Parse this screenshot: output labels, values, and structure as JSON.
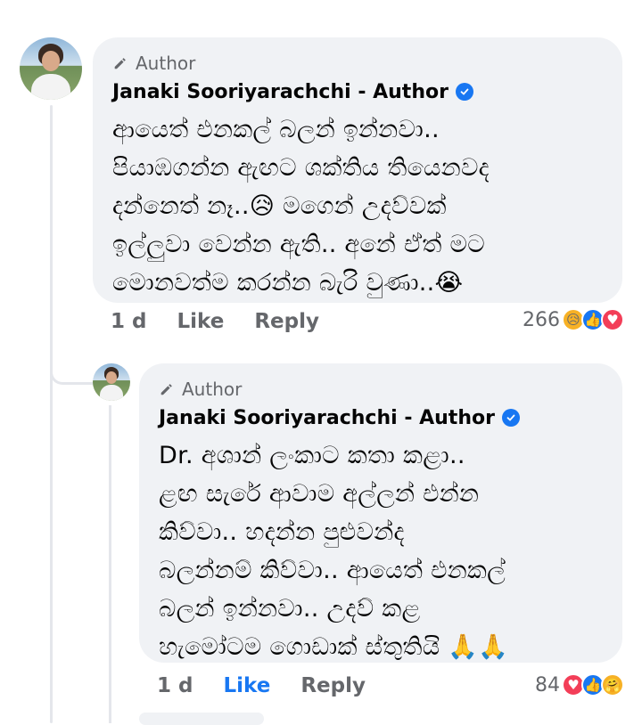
{
  "comments": [
    {
      "badge": "Author",
      "name": "Janaki Sooriyarachchi - Author",
      "text": "ආයෙත් එනකල් බලන් ඉන්නවා..\nපියාඹගන්න ඇඟට ශක්තිය තියෙනවද\nදන්නෙත් නෑ..😥 මගෙන් උදව්වක්\nඉල්ලුවා වෙන්න ඇති.. අනේ ඒත් මට\nමොනවත්ම කරන්න බැරි වුණා..😭",
      "time": "1 d",
      "like_label": "Like",
      "reply_label": "Reply",
      "reaction_count": "266",
      "reactions": [
        "sad",
        "like",
        "love"
      ]
    },
    {
      "badge": "Author",
      "name": "Janaki Sooriyarachchi - Author",
      "text": "Dr. අශාන් ලංකාට කතා කළා..\nළඟ සැරේ ආවාම අල්ලන් එන්න\nකිව්වා.. හදන්න පුළුවන්ද\nබලන්නම් කිව්වා.. ආයෙත් එනකල්\nබලන් ඉන්නවා.. උදව් කළ\nහැමෝටම ගොඩාක් ස්තුතියි 🙏🙏",
      "time": "1 d",
      "like_label": "Like",
      "reply_label": "Reply",
      "reaction_count": "84",
      "reactions": [
        "love",
        "like",
        "care"
      ]
    }
  ],
  "colors": {
    "bubble": "#f0f2f5",
    "meta_text": "#65676b",
    "accent": "#1877f2",
    "love": "#f33e58",
    "reaction_yellow": "#f7b125"
  },
  "icons": {
    "badge": "pencil-icon",
    "verified": "verified-check-icon"
  }
}
